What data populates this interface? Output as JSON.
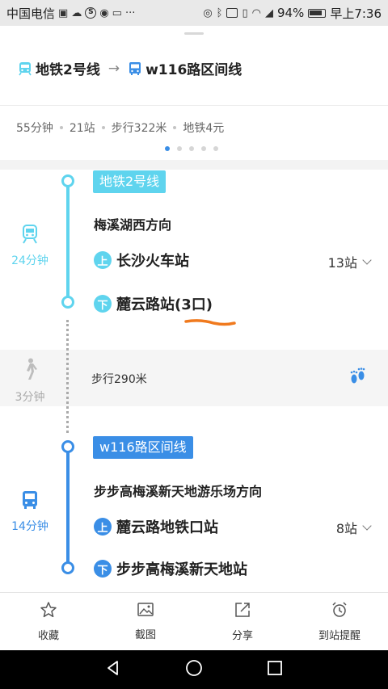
{
  "status_bar": {
    "carrier": "中国电信",
    "battery": "94%",
    "time": "早上7:36"
  },
  "route": {
    "line1": "地铁2号线",
    "line2": "w116路区间线",
    "arrow": "→"
  },
  "summary": {
    "duration": "55分钟",
    "stops": "21站",
    "walk": "步行322米",
    "fare": "地铁4元"
  },
  "pager": {
    "count": 5,
    "active": 1
  },
  "colors": {
    "subway": "#5fd4ee",
    "bus": "#3a8ee6",
    "orange_mark": "#f07a1e"
  },
  "segments": {
    "subway": {
      "tag": "地铁2号线",
      "direction": "梅溪湖西方向",
      "board_badge": "上",
      "board_stop": "长沙火车站",
      "stop_count": "13站",
      "alight_badge": "下",
      "alight_stop": "麓云路站(3口)",
      "time": "24分钟",
      "icon": "subway-icon"
    },
    "walk": {
      "time": "3分钟",
      "text": "步行290米",
      "icon": "walking-person-icon"
    },
    "bus": {
      "tag": "w116路区间线",
      "direction": "步步高梅溪新天地游乐场方向",
      "board_badge": "上",
      "board_stop": "麓云路地铁口站",
      "stop_count": "8站",
      "alight_badge": "下",
      "alight_stop": "步步高梅溪新天地站",
      "time": "14分钟",
      "icon": "bus-icon"
    }
  },
  "actions": {
    "favorite": "收藏",
    "screenshot": "截图",
    "share": "分享",
    "arrival_alert": "到站提醒"
  }
}
